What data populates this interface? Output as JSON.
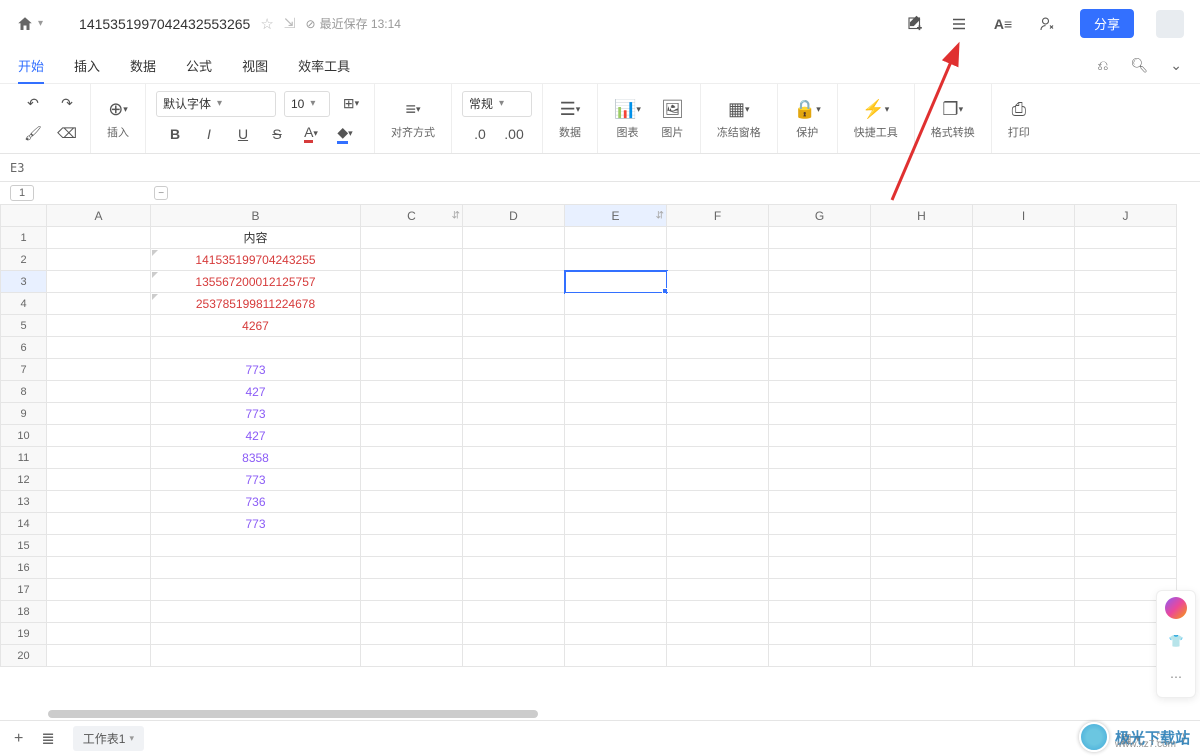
{
  "titlebar": {
    "doc_title": "141535199704243255​3265",
    "save_status": "最近保存 13:14",
    "share_label": "分享"
  },
  "menu": {
    "tabs": [
      "开始",
      "插入",
      "数据",
      "公式",
      "视图",
      "效率工具"
    ],
    "active": 0
  },
  "toolbar": {
    "insert_label": "插入",
    "font_family": "默认字体",
    "font_size": "10",
    "align_label": "对齐方式",
    "number_format": "常规",
    "number_sample": ".0",
    "number_sample2": ".00",
    "data_label": "数据",
    "chart_label": "图表",
    "image_label": "图片",
    "freeze_label": "冻结窗格",
    "protect_label": "保护",
    "quick_label": "快捷工具",
    "convert_label": "格式转换",
    "print_label": "打印"
  },
  "cell_ref": "E3",
  "sheet_group_tab": "1",
  "columns": [
    "A",
    "B",
    "C",
    "D",
    "E",
    "F",
    "G",
    "H",
    "I",
    "J"
  ],
  "rows": [
    {
      "n": 1,
      "B": "内容",
      "cls": ""
    },
    {
      "n": 2,
      "B": "141535199704243255",
      "cls": "red",
      "tri": true
    },
    {
      "n": 3,
      "B": "135567200012125757",
      "cls": "red",
      "tri": true
    },
    {
      "n": 4,
      "B": "253785199811224678",
      "cls": "red",
      "tri": true
    },
    {
      "n": 5,
      "B": "4267",
      "cls": "red"
    },
    {
      "n": 6,
      "B": "",
      "cls": ""
    },
    {
      "n": 7,
      "B": "773",
      "cls": "purple"
    },
    {
      "n": 8,
      "B": "427",
      "cls": "purple"
    },
    {
      "n": 9,
      "B": "773",
      "cls": "purple"
    },
    {
      "n": 10,
      "B": "427",
      "cls": "purple"
    },
    {
      "n": 11,
      "B": "8358",
      "cls": "purple"
    },
    {
      "n": 12,
      "B": "773",
      "cls": "purple"
    },
    {
      "n": 13,
      "B": "736",
      "cls": "purple"
    },
    {
      "n": 14,
      "B": "773",
      "cls": "purple"
    },
    {
      "n": 15
    },
    {
      "n": 16
    },
    {
      "n": 17
    },
    {
      "n": 18
    },
    {
      "n": 19
    },
    {
      "n": 20
    }
  ],
  "selected": {
    "row": 3,
    "col": "E"
  },
  "bottom": {
    "sheet_name": "工作表1"
  },
  "watermark": {
    "main": "极光下载站",
    "sub": "www.xz7.com"
  }
}
